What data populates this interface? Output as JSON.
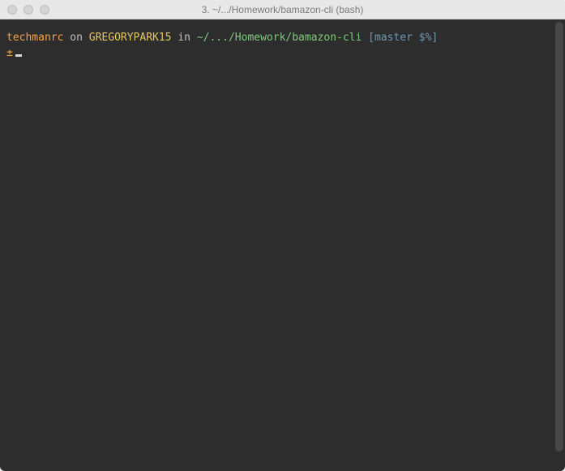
{
  "titlebar": {
    "title": "3. ~/.../Homework/bamazon-cli (bash)"
  },
  "prompt": {
    "user": "techmanrc",
    "on": " on ",
    "host": "GREGORYPARK15",
    "in": " in ",
    "path": "~/.../Homework/bamazon-cli",
    "git": " [master $%]",
    "symbol": "±"
  }
}
